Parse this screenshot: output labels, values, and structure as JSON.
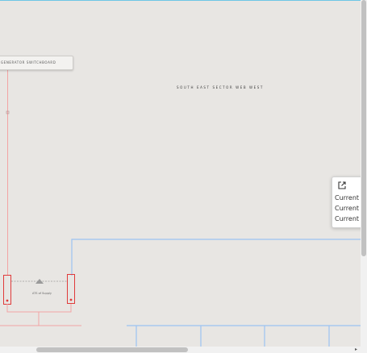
{
  "diagram": {
    "generator_label": "GENERATOR SWITCHBOARD",
    "sector_title": "SOUTH EAST SECTOR WEB WEST",
    "ats_label": "ATS of Supply"
  },
  "popup": {
    "icon": "external-link-icon",
    "rows": [
      "Current P",
      "Current P",
      "Current P"
    ]
  },
  "colors": {
    "red_line": "#f2a4a4",
    "red_box": "#e03a3a",
    "blue_line": "#9cc3f2",
    "background": "#e8e6e3"
  }
}
